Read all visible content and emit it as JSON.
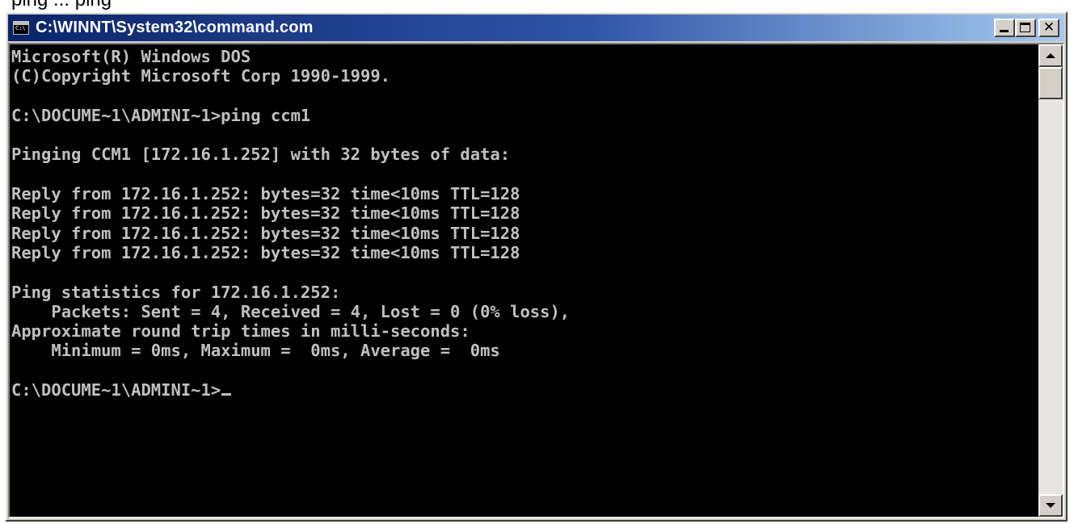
{
  "top_strip_text": "ping ... ping",
  "window": {
    "title": "C:\\WINNT\\System32\\command.com",
    "icon": "console-app-icon",
    "buttons": {
      "minimize": "minimize-icon",
      "maximize": "maximize-icon",
      "close": "close-icon",
      "close_glyph": "✕"
    }
  },
  "console": {
    "lines": [
      "Microsoft(R) Windows DOS",
      "(C)Copyright Microsoft Corp 1990-1999.",
      "",
      "C:\\DOCUME~1\\ADMINI~1>ping ccm1",
      "",
      "Pinging CCM1 [172.16.1.252] with 32 bytes of data:",
      "",
      "Reply from 172.16.1.252: bytes=32 time<10ms TTL=128",
      "Reply from 172.16.1.252: bytes=32 time<10ms TTL=128",
      "Reply from 172.16.1.252: bytes=32 time<10ms TTL=128",
      "Reply from 172.16.1.252: bytes=32 time<10ms TTL=128",
      "",
      "Ping statistics for 172.16.1.252:",
      "    Packets: Sent = 4, Received = 4, Lost = 0 (0% loss),",
      "Approximate round trip times in milli-seconds:",
      "    Minimum = 0ms, Maximum =  0ms, Average =  0ms",
      ""
    ],
    "prompt": "C:\\DOCUME~1\\ADMINI~1>"
  },
  "colors": {
    "title_bar_start": "#0a246a",
    "title_bar_end": "#a6caf0",
    "console_bg": "#000000",
    "console_fg": "#c0c0c0"
  }
}
